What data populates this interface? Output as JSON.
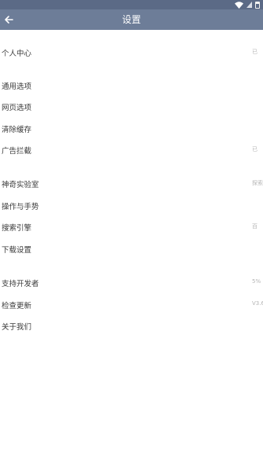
{
  "header": {
    "title": "设置"
  },
  "icons": {
    "back": "arrow-left-icon",
    "wifi": "wifi-icon",
    "signal": "signal-icon",
    "battery": "battery-icon"
  },
  "colors": {
    "appbar": "#6d7d98",
    "statusbar": "#5b6a86"
  },
  "groups": [
    {
      "items": [
        {
          "label": "个人中心",
          "value": "已"
        }
      ]
    },
    {
      "items": [
        {
          "label": "通用选项",
          "value": ""
        },
        {
          "label": "网页选项",
          "value": ""
        },
        {
          "label": "清除缓存",
          "value": ""
        },
        {
          "label": "广告拦截",
          "value": "已"
        }
      ]
    },
    {
      "items": [
        {
          "label": "神奇实验室",
          "value": "探索"
        },
        {
          "label": "操作与手势",
          "value": ""
        },
        {
          "label": "搜索引擎",
          "value": "百"
        },
        {
          "label": "下载设置",
          "value": ""
        }
      ]
    },
    {
      "items": [
        {
          "label": "支持开发者",
          "value": "5%"
        },
        {
          "label": "检查更新",
          "value": "V3.6"
        },
        {
          "label": "关于我们",
          "value": ""
        }
      ]
    }
  ]
}
